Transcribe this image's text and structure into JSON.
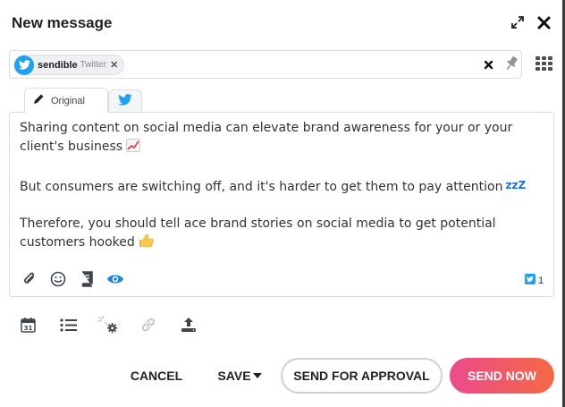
{
  "dialog": {
    "title": "New message"
  },
  "recipients": {
    "chip_name": "sendible",
    "chip_network": "Twitter"
  },
  "tabs": {
    "original_label": "Original"
  },
  "message": {
    "para1": "Sharing content on social media can elevate brand awareness for your or your client's business",
    "para2": "But consumers are switching off, and it's harder to get them to pay attention",
    "para3": "Therefore, you should tell ace brand stories on social media to get potential customers hooked",
    "zz": "zzZ",
    "twitter_count": "1"
  },
  "buttons": {
    "cancel": "CANCEL",
    "save": "SAVE",
    "send_for_approval": "SEND FOR APPROVAL",
    "send_now": "SEND NOW"
  },
  "colors": {
    "twitter_blue": "#1da1f2",
    "send_gradient_start": "#ec4a8d",
    "send_gradient_end": "#f46a43"
  },
  "icons": {
    "header": [
      "expand-icon",
      "close-icon"
    ],
    "recipients": [
      "twitter-icon",
      "remove-chip-icon",
      "clear-icon",
      "pin-icon",
      "grid-icon"
    ],
    "editor_toolbar": [
      "attachment-icon",
      "emoji-icon",
      "library-icon",
      "preview-icon"
    ],
    "bottom_toolbar": [
      "calendar-icon",
      "list-icon",
      "settings-icon",
      "link-icon",
      "upload-icon"
    ]
  }
}
